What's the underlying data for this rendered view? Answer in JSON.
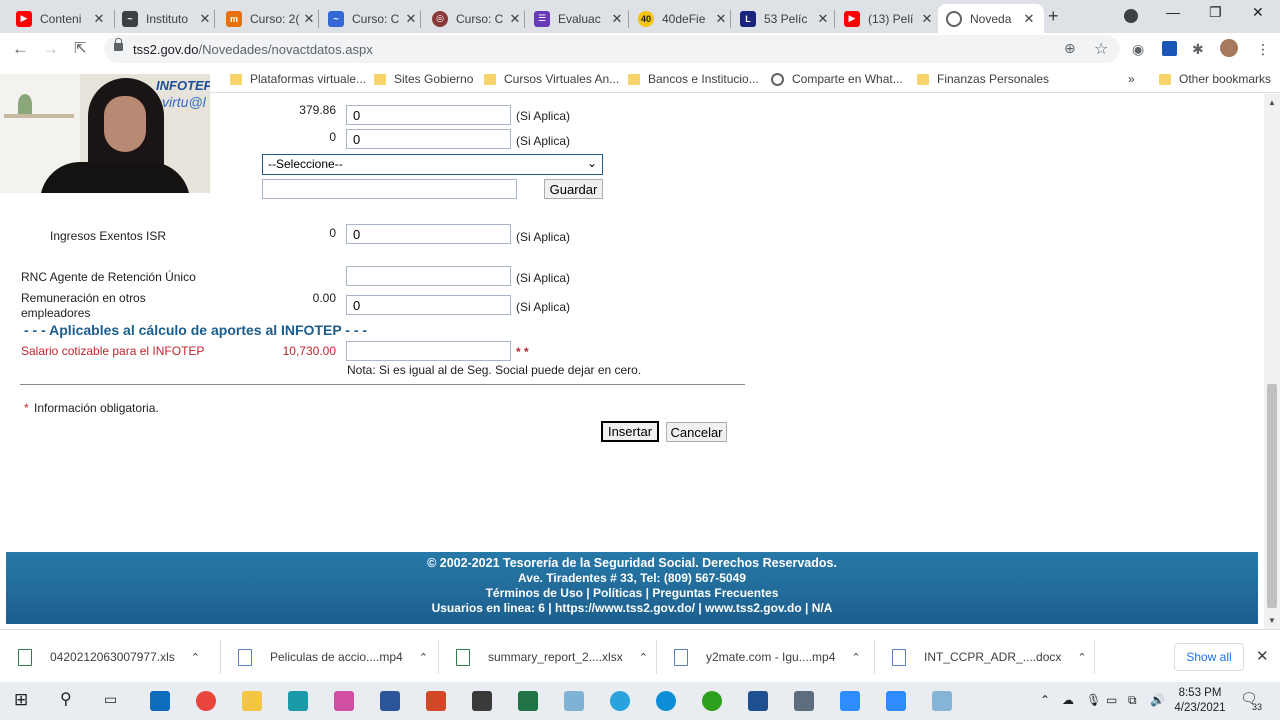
{
  "browser": {
    "tabs": [
      {
        "title": "Conteni",
        "icon": "youtube-icon",
        "color": "#ff0000"
      },
      {
        "title": "Instituto",
        "icon": "chart-icon",
        "color": "#3c4043"
      },
      {
        "title": "Curso: 2(",
        "icon": "course-icon",
        "color": "#e8710a"
      },
      {
        "title": "Curso: C",
        "icon": "course-icon",
        "color": "#3367d6"
      },
      {
        "title": "Curso: C",
        "icon": "course-icon",
        "color": "#8b3a3a"
      },
      {
        "title": "Evaluac",
        "icon": "forms-icon",
        "color": "#673ab7"
      },
      {
        "title": "40deFie",
        "icon": "site-icon",
        "color": "#f2c40f"
      },
      {
        "title": "53 Pelíc",
        "icon": "letter-l-icon",
        "color": "#1a237e"
      },
      {
        "title": "(13) Pelí",
        "icon": "youtube-icon",
        "color": "#ff0000"
      },
      {
        "title": "Noveda",
        "icon": "globe-icon",
        "color": "#5f6368"
      }
    ],
    "url": {
      "host": "tss2.gov.do",
      "path": "/Novedades/novactdatos.aspx"
    },
    "bookmarks": [
      "Plataformas virtuale...",
      "Sites Gobierno",
      "Cursos Virtuales An...",
      "Bancos e Institucio...",
      "Comparte en What...",
      "Finanzas Personales",
      "Other bookmarks"
    ]
  },
  "form": {
    "row1": {
      "value": "379.86",
      "input": "0",
      "hint": "(Si Aplica)"
    },
    "row2": {
      "value": "0",
      "input": "0",
      "hint": "(Si Aplica)"
    },
    "select": "--Seleccione--",
    "guardar": "Guardar",
    "ingresos": {
      "label": "Ingresos Exentos ISR",
      "value": "0",
      "input": "0",
      "hint": "(Si Aplica)"
    },
    "rnc": {
      "label": "RNC Agente de Retención Único",
      "hint": "(Si Aplica)"
    },
    "remuneracion": {
      "label_1": "Remuneración en otros",
      "label_2": "empleadores",
      "value": "0.00",
      "input": "0",
      "hint": "(Si Aplica)"
    },
    "section_title": "- - - Aplicables al cálculo de aportes al INFOTEP - - -",
    "salario": {
      "label": "Salario  cotizable para el INFOTEP",
      "value": "10,730.00",
      "required": "* *"
    },
    "nota": "Nota: Si es igual al de Seg. Social puede dejar en cero.",
    "required_mark": "*",
    "required_note": "Información obligatoria.",
    "insertar": "Insertar",
    "cancelar": "Cancelar"
  },
  "footer": {
    "line1": "© 2002-2021 Tesorería de la Seguridad Social. Derechos Reservados.",
    "line2": "Ave. Tiradentes # 33, Tel: (809) 567-5049",
    "line3": "Términos de Uso | Políticas | Preguntas Frecuentes",
    "line4": "Usuarios en linea: 6  | https://www.tss2.gov.do/ | www.tss2.gov.do | N/A"
  },
  "webcam": {
    "logo": "INFOTEP",
    "logo_sub": "virtu@l"
  },
  "downloads": {
    "items": [
      {
        "name": "0420212063007977.xls",
        "type": "excel"
      },
      {
        "name": "Peliculas de accio....mp4",
        "type": "video"
      },
      {
        "name": "summary_report_2....xlsx",
        "type": "excel"
      },
      {
        "name": "y2mate.com - Igu....mp4",
        "type": "video"
      },
      {
        "name": "INT_CCPR_ADR_....docx",
        "type": "word"
      }
    ],
    "show_all": "Show all"
  },
  "taskbar": {
    "time": "8:53 PM",
    "date": "4/23/2021",
    "notifications": "33",
    "apps": [
      {
        "name": "outlook-icon",
        "color": "#0f6cbd"
      },
      {
        "name": "chrome-icon",
        "color": "#e8453c"
      },
      {
        "name": "file-explorer-icon",
        "color": "#f4c542"
      },
      {
        "name": "messaging-icon",
        "color": "#1b9aaa"
      },
      {
        "name": "snipping-icon",
        "color": "#d04fa4"
      },
      {
        "name": "word-icon",
        "color": "#2b579a"
      },
      {
        "name": "powerpoint-icon",
        "color": "#d24726"
      },
      {
        "name": "notes-icon",
        "color": "#3a3a3a"
      },
      {
        "name": "excel-icon",
        "color": "#217346"
      },
      {
        "name": "paint-icon",
        "color": "#7fb3d5"
      },
      {
        "name": "telegram-icon",
        "color": "#2aa3dc"
      },
      {
        "name": "edge-icon",
        "color": "#0c8dd6"
      },
      {
        "name": "quickbooks-icon",
        "color": "#2ca01c"
      },
      {
        "name": "video-editor-icon",
        "color": "#1e4f8f"
      },
      {
        "name": "calculator-icon",
        "color": "#5d6d7e"
      },
      {
        "name": "zoom-icon",
        "color": "#2d8cff"
      },
      {
        "name": "zoom-meetings-icon",
        "color": "#2d8cff"
      },
      {
        "name": "app-icon",
        "color": "#86b4d6"
      }
    ]
  }
}
